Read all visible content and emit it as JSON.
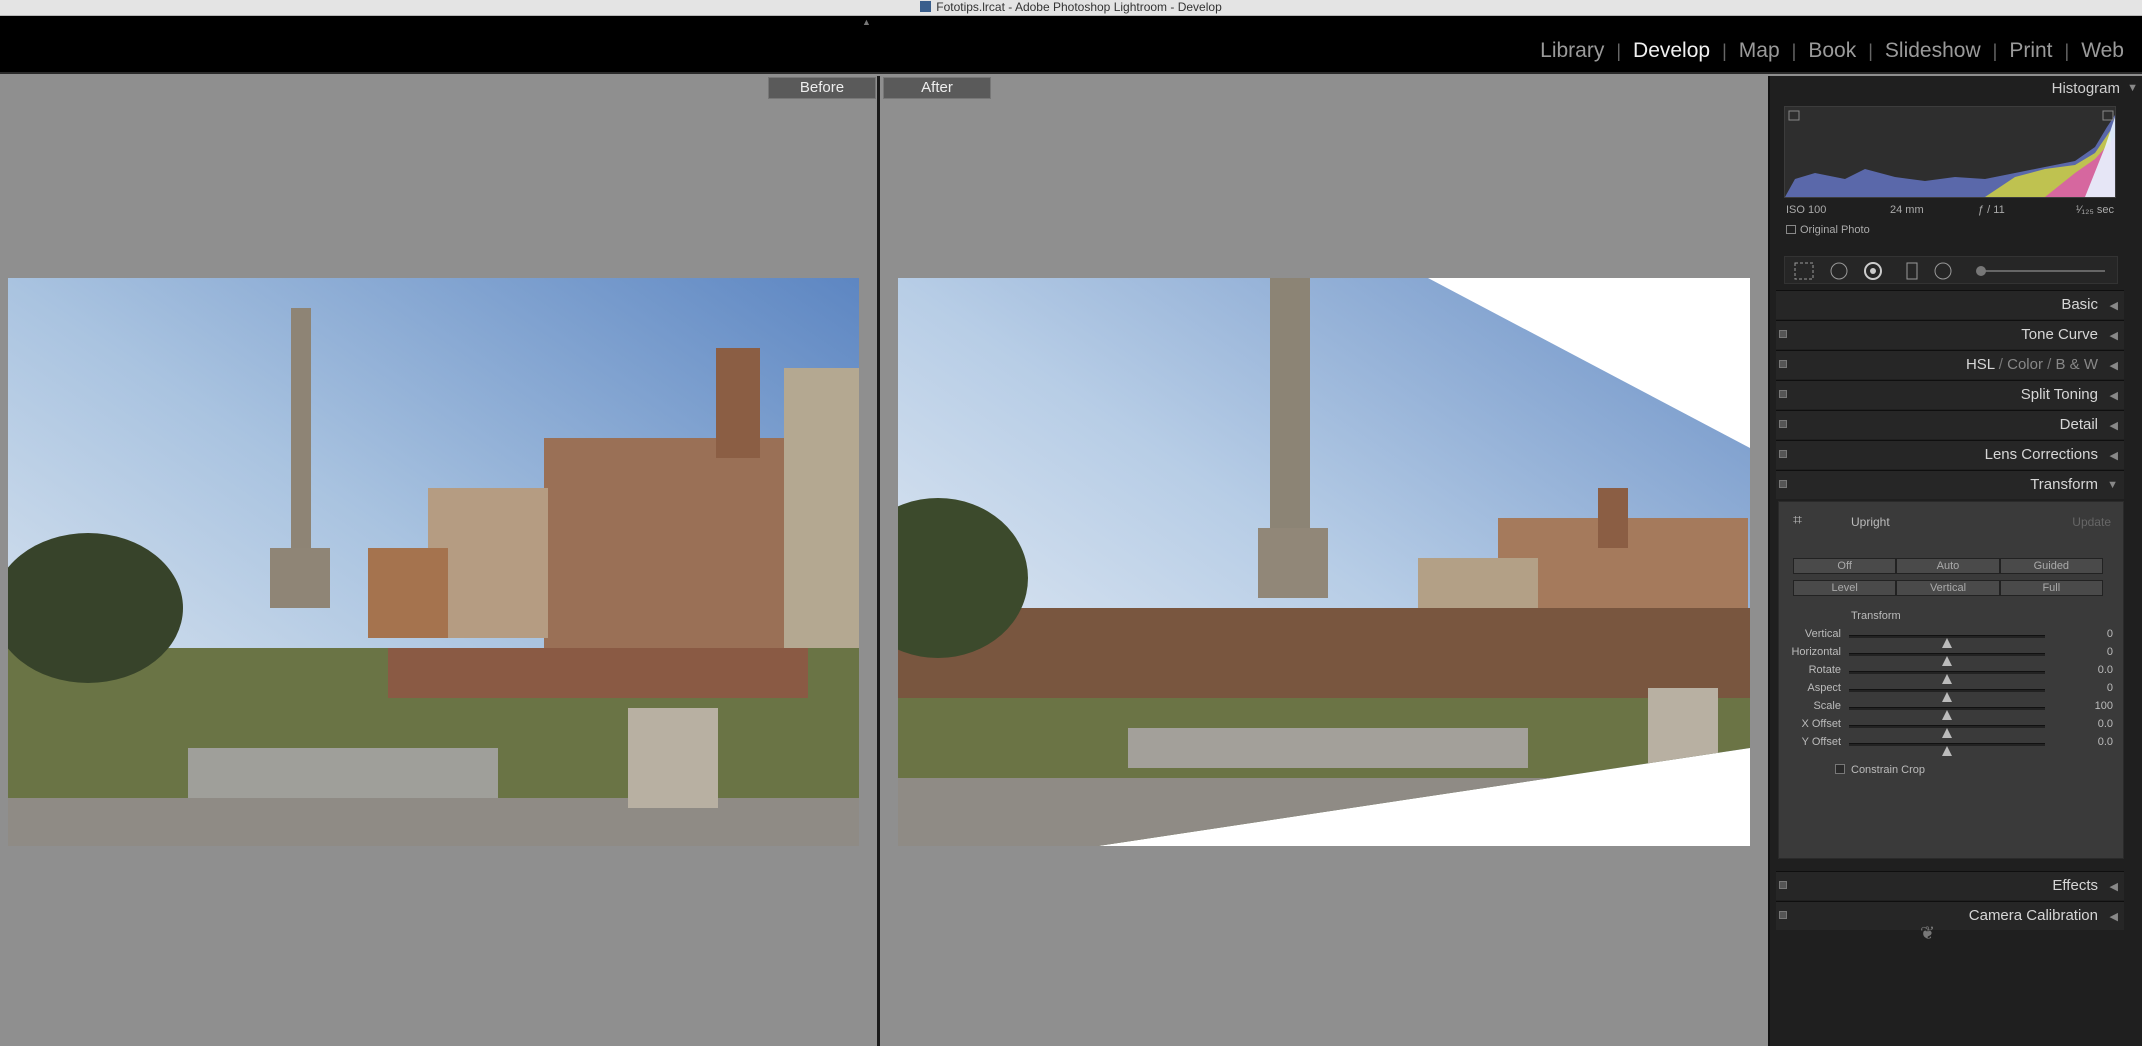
{
  "window": {
    "title": "Fototips.lrcat - Adobe Photoshop Lightroom - Develop"
  },
  "modules": [
    {
      "label": "Library",
      "active": false
    },
    {
      "label": "Develop",
      "active": true
    },
    {
      "label": "Map",
      "active": false
    },
    {
      "label": "Book",
      "active": false
    },
    {
      "label": "Slideshow",
      "active": false
    },
    {
      "label": "Print",
      "active": false
    },
    {
      "label": "Web",
      "active": false
    }
  ],
  "compare": {
    "before_label": "Before",
    "after_label": "After"
  },
  "histogram": {
    "title": "Histogram",
    "iso": "ISO 100",
    "focal": "24 mm",
    "aperture": "ƒ / 11",
    "shutter": "¹⁄₁₂₅ sec",
    "original_photo_label": "Original Photo"
  },
  "sections": {
    "basic": "Basic",
    "tone_curve": "Tone Curve",
    "hsl": "HSL",
    "hsl_sep": "/",
    "color": "Color",
    "bw": "B & W",
    "split_toning": "Split Toning",
    "detail": "Detail",
    "lens_corrections": "Lens Corrections",
    "transform": "Transform",
    "effects": "Effects",
    "camera_calibration": "Camera Calibration"
  },
  "transform": {
    "upright_label": "Upright",
    "update_label": "Update",
    "buttons_row1": [
      "Off",
      "Auto",
      "Guided"
    ],
    "buttons_row2": [
      "Level",
      "Vertical",
      "Full"
    ],
    "subheading": "Transform",
    "sliders": [
      {
        "label": "Vertical",
        "value": "0",
        "fraction": 0.5
      },
      {
        "label": "Horizontal",
        "value": "0",
        "fraction": 0.5
      },
      {
        "label": "Rotate",
        "value": "0.0",
        "fraction": 0.5
      },
      {
        "label": "Aspect",
        "value": "0",
        "fraction": 0.5
      },
      {
        "label": "Scale",
        "value": "100",
        "fraction": 0.5
      },
      {
        "label": "X Offset",
        "value": "0.0",
        "fraction": 0.5
      },
      {
        "label": "Y Offset",
        "value": "0.0",
        "fraction": 0.5
      }
    ],
    "constrain_crop_label": "Constrain Crop"
  },
  "colors": {
    "panel_bg": "#1f1f1f",
    "workarea_bg": "#8f8f8f",
    "active_module": "#f0f0f0"
  }
}
